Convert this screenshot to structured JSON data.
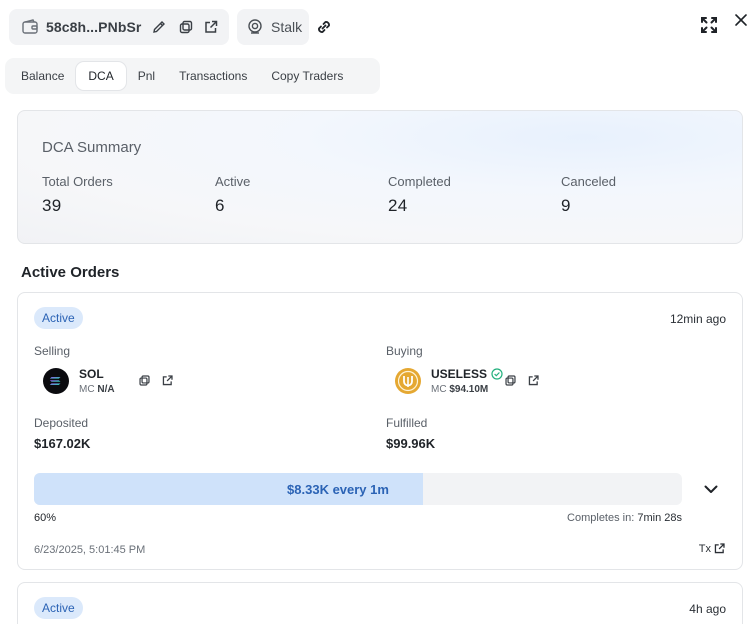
{
  "header": {
    "wallet_address": "58c8h...PNbSr",
    "stalk_label": "Stalk"
  },
  "tabs": [
    {
      "label": "Balance"
    },
    {
      "label": "DCA"
    },
    {
      "label": "Pnl"
    },
    {
      "label": "Transactions"
    },
    {
      "label": "Copy Traders"
    }
  ],
  "active_tab": "DCA",
  "summary": {
    "title": "DCA Summary",
    "stats": [
      {
        "label": "Total Orders",
        "value": "39"
      },
      {
        "label": "Active",
        "value": "6"
      },
      {
        "label": "Completed",
        "value": "24"
      },
      {
        "label": "Canceled",
        "value": "9"
      }
    ]
  },
  "active_orders": {
    "title": "Active Orders",
    "orders": [
      {
        "status": "Active",
        "time_ago": "12min ago",
        "selling_label": "Selling",
        "buying_label": "Buying",
        "selling_token": {
          "symbol": "SOL",
          "mc_label": "MC",
          "mc_value": "N/A"
        },
        "buying_token": {
          "symbol": "USELESS",
          "mc_label": "MC",
          "mc_value": "$94.10M"
        },
        "deposited_label": "Deposited",
        "deposited_value": "$167.02K",
        "fulfilled_label": "Fulfilled",
        "fulfilled_value": "$99.96K",
        "progress_text": "$8.33K every 1m",
        "progress_fraction": 0.6,
        "progress_percent": "60%",
        "completes_label": "Completes in:",
        "completes_value": "7min 28s",
        "created_at": "6/23/2025, 5:01:45 PM",
        "tx_label": "Tx"
      },
      {
        "status": "Active",
        "time_ago": "4h ago"
      }
    ]
  },
  "colors": {
    "accent_blue": "#2b63b5",
    "badge_bg": "#dbe9fb",
    "progress_fill": "#cfe2fa",
    "verified_green": "#22b07d",
    "useless_gold": "#e5a832"
  }
}
